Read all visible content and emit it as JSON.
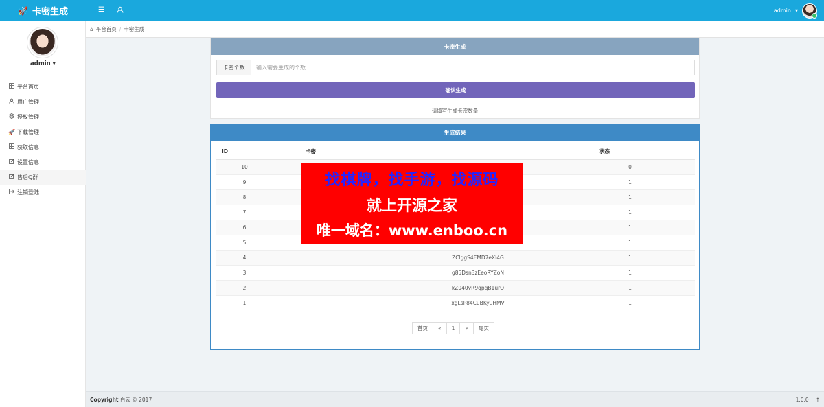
{
  "header": {
    "brand": "卡密生成",
    "menu_icon": "list-icon",
    "user_icon": "user-icon",
    "username": "admin",
    "caret": "▾"
  },
  "sidebar": {
    "username": "admin",
    "caret": "▾",
    "items": [
      {
        "label": "平台首页",
        "icon": "grid-icon"
      },
      {
        "label": "用户管理",
        "icon": "user-icon"
      },
      {
        "label": "授权管理",
        "icon": "layers-icon"
      },
      {
        "label": "下载管理",
        "icon": "rocket-icon"
      },
      {
        "label": "获取信息",
        "icon": "grid-icon"
      },
      {
        "label": "设置信息",
        "icon": "edit-icon"
      },
      {
        "label": "售后Q群",
        "icon": "edit-icon"
      },
      {
        "label": "注销登陆",
        "icon": "logout-icon"
      }
    ]
  },
  "breadcrumb": {
    "home": "平台首页",
    "separator": "/",
    "current": "卡密生成"
  },
  "generate_panel": {
    "title": "卡密生成",
    "input_label": "卡密个数",
    "input_placeholder": "输入需要生成的个数",
    "input_value": "",
    "button_label": "确认生成",
    "hint": "请填写生成卡密数量"
  },
  "results_panel": {
    "title": "生成结果",
    "columns": [
      "ID",
      "卡密",
      "状态"
    ],
    "rows": [
      {
        "id": "10",
        "key": "",
        "status": "0"
      },
      {
        "id": "9",
        "key": "",
        "status": "1"
      },
      {
        "id": "8",
        "key": "",
        "status": "1"
      },
      {
        "id": "7",
        "key": "",
        "status": "1"
      },
      {
        "id": "6",
        "key": "",
        "status": "1"
      },
      {
        "id": "5",
        "key": "",
        "status": "1"
      },
      {
        "id": "4",
        "key": "ZClggS4EMD7eXl4G",
        "status": "1"
      },
      {
        "id": "3",
        "key": "g85Dsn3zEeoRYZoN",
        "status": "1"
      },
      {
        "id": "2",
        "key": "kZ040vR9qpqB1urQ",
        "status": "1"
      },
      {
        "id": "1",
        "key": "xgLsP84CuBKyuHMV",
        "status": "1"
      }
    ],
    "pager": {
      "first": "首页",
      "prev": "«",
      "current": "1",
      "next": "»",
      "last": "尾页"
    }
  },
  "banner": {
    "line1": "找棋牌，找手游，找源码",
    "line2": "就上开源之家",
    "line3": "唯一域名：www.enboo.cn"
  },
  "footer": {
    "copyright_label": "Copyright",
    "copyright_text": "白云 © 2017",
    "version": "1.0.0",
    "up_icon": "↑"
  }
}
